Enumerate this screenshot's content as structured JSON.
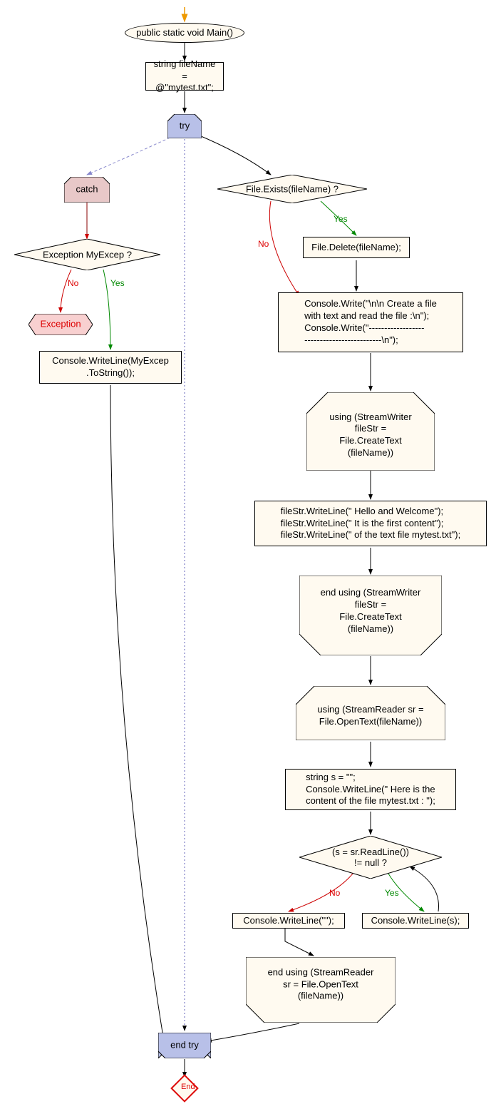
{
  "nodes": {
    "start_arrow": "",
    "main_decl": "public static void Main()",
    "filename_box": "string fileName\n= @\"mytest.txt\";",
    "try_label": "try",
    "catch_label": "catch",
    "exception_test": "Exception MyExcep ?",
    "exception_term": "Exception",
    "writeline_excep": "Console.WriteLine(MyExcep\n.ToString());",
    "file_exists": "File.Exists(fileName) ?",
    "file_delete": "File.Delete(fileName);",
    "console_write_header": "Console.Write(\"\\n\\n Create a file\nwith text and read the file  :\\n\");\nConsole.Write(\"------------------\n-------------------------\\n\");",
    "using_writer": "using (StreamWriter\nfileStr =\nFile.CreateText\n(fileName))",
    "writer_lines": "fileStr.WriteLine(\" Hello and Welcome\");\nfileStr.WriteLine(\" It is the first content\");\nfileStr.WriteLine(\" of the text file mytest.txt\");",
    "end_using_writer": "end using (StreamWriter\nfileStr =\nFile.CreateText\n(fileName))",
    "using_reader": "using (StreamReader sr =\nFile.OpenText(fileName))",
    "reader_init": "string s = \"\";\nConsole.WriteLine(\" Here is the\ncontent of the file mytest.txt : \");",
    "readline_test": "(s = sr.ReadLine())\n!= null ?",
    "writeline_empty": "Console.WriteLine(\"\");",
    "writeline_s": "Console.WriteLine(s);",
    "end_using_reader": "end using (StreamReader\nsr = File.OpenText\n(fileName))",
    "end_try": "end try",
    "end": "End"
  },
  "labels": {
    "yes": "Yes",
    "no": "No"
  },
  "colors": {
    "node_bg": "#fffaf0",
    "try_bg": "#b8c0e8",
    "catch_bg": "#e8c8c8",
    "exception_bg": "#f8d0d0",
    "border": "#000000",
    "yes": "#008800",
    "no": "#cc0000",
    "arrow": "#000000",
    "catch_arrow": "#8888cc",
    "try_arrow": "#6666bb"
  },
  "chart_data": {
    "type": "flowchart",
    "nodes": [
      {
        "id": "start",
        "kind": "entry"
      },
      {
        "id": "main",
        "kind": "terminal",
        "label": "public static void Main()"
      },
      {
        "id": "filename",
        "kind": "process",
        "label": "string fileName = @\"mytest.txt\";"
      },
      {
        "id": "try",
        "kind": "try-block",
        "label": "try"
      },
      {
        "id": "catch",
        "kind": "catch-block",
        "label": "catch"
      },
      {
        "id": "excep_test",
        "kind": "decision",
        "label": "Exception MyExcep ?"
      },
      {
        "id": "excep_term",
        "kind": "terminal",
        "label": "Exception"
      },
      {
        "id": "wl_excep",
        "kind": "process",
        "label": "Console.WriteLine(MyExcep.ToString());"
      },
      {
        "id": "file_exists",
        "kind": "decision",
        "label": "File.Exists(fileName) ?"
      },
      {
        "id": "file_delete",
        "kind": "process",
        "label": "File.Delete(fileName);"
      },
      {
        "id": "hdr",
        "kind": "process",
        "label": "Console.Write header lines"
      },
      {
        "id": "use_w",
        "kind": "using-open",
        "label": "using (StreamWriter fileStr = File.CreateText(fileName))"
      },
      {
        "id": "wlines",
        "kind": "process",
        "label": "fileStr.WriteLine x3"
      },
      {
        "id": "end_w",
        "kind": "using-close",
        "label": "end using StreamWriter"
      },
      {
        "id": "use_r",
        "kind": "using-open",
        "label": "using (StreamReader sr = File.OpenText(fileName))"
      },
      {
        "id": "rinit",
        "kind": "process",
        "label": "string s = \"\"; Console.WriteLine(...)"
      },
      {
        "id": "rl_test",
        "kind": "decision",
        "label": "(s = sr.ReadLine()) != null ?"
      },
      {
        "id": "wl_empty",
        "kind": "process",
        "label": "Console.WriteLine(\"\");"
      },
      {
        "id": "wl_s",
        "kind": "process",
        "label": "Console.WriteLine(s);"
      },
      {
        "id": "end_r",
        "kind": "using-close",
        "label": "end using StreamReader"
      },
      {
        "id": "end_try",
        "kind": "try-close",
        "label": "end try"
      },
      {
        "id": "end",
        "kind": "end",
        "label": "End"
      }
    ],
    "edges": [
      {
        "from": "start",
        "to": "main"
      },
      {
        "from": "main",
        "to": "filename"
      },
      {
        "from": "filename",
        "to": "try"
      },
      {
        "from": "try",
        "to": "file_exists"
      },
      {
        "from": "try",
        "to": "catch",
        "style": "dashed"
      },
      {
        "from": "try",
        "to": "end_try",
        "style": "dotted"
      },
      {
        "from": "catch",
        "to": "excep_test"
      },
      {
        "from": "excep_test",
        "to": "wl_excep",
        "label": "Yes"
      },
      {
        "from": "excep_test",
        "to": "excep_term",
        "label": "No"
      },
      {
        "from": "wl_excep",
        "to": "end_try"
      },
      {
        "from": "file_exists",
        "to": "file_delete",
        "label": "Yes"
      },
      {
        "from": "file_exists",
        "to": "hdr",
        "label": "No"
      },
      {
        "from": "file_delete",
        "to": "hdr"
      },
      {
        "from": "hdr",
        "to": "use_w"
      },
      {
        "from": "use_w",
        "to": "wlines"
      },
      {
        "from": "wlines",
        "to": "end_w"
      },
      {
        "from": "end_w",
        "to": "use_r"
      },
      {
        "from": "use_r",
        "to": "rinit"
      },
      {
        "from": "rinit",
        "to": "rl_test"
      },
      {
        "from": "rl_test",
        "to": "wl_s",
        "label": "Yes"
      },
      {
        "from": "wl_s",
        "to": "rl_test"
      },
      {
        "from": "rl_test",
        "to": "wl_empty",
        "label": "No"
      },
      {
        "from": "wl_empty",
        "to": "end_r"
      },
      {
        "from": "end_r",
        "to": "end_try"
      },
      {
        "from": "end_try",
        "to": "end"
      }
    ]
  }
}
